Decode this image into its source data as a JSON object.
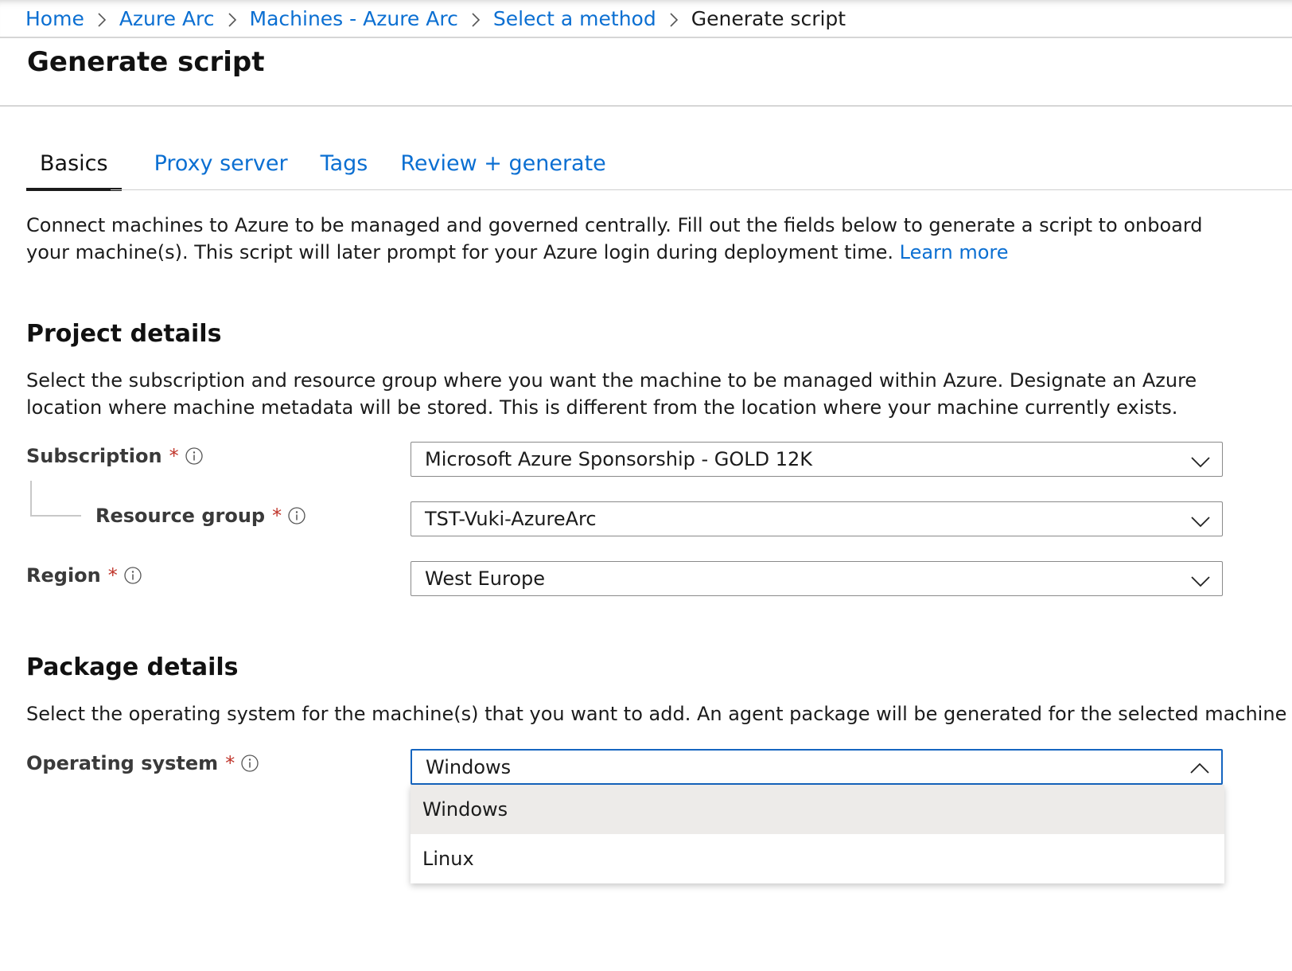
{
  "breadcrumb": {
    "items": [
      "Home",
      "Azure Arc",
      "Machines - Azure Arc",
      "Select a method"
    ],
    "current": "Generate script"
  },
  "page_title": "Generate script",
  "tabs": [
    "Basics",
    "Proxy server",
    "Tags",
    "Review + generate"
  ],
  "active_tab": "Basics",
  "intro": {
    "text": "Connect machines to Azure to be managed and governed centrally. Fill out the fields below to generate a script to onboard your machine(s). This script will later prompt for your Azure login during deployment time.",
    "link": "Learn more"
  },
  "project": {
    "title": "Project details",
    "description": "Select the subscription and resource group where you want the machine to be managed within Azure. Designate an Azure location where machine metadata will be stored. This is different from the location where your machine currently exists.",
    "subscription_label": "Subscription",
    "subscription_value": "Microsoft Azure Sponsorship - GOLD 12K",
    "resource_group_label": "Resource group",
    "resource_group_value": "TST-Vuki-AzureArc",
    "region_label": "Region",
    "region_value": "West Europe"
  },
  "package": {
    "title": "Package details",
    "description": "Select the operating system for the machine(s) that you want to add. An agent package will be generated for the selected machine type.",
    "os_label": "Operating system",
    "os_value": "Windows",
    "os_options": [
      "Windows",
      "Linux"
    ],
    "os_selected": "Windows"
  },
  "required_marker": "*",
  "icons": {
    "breadcrumb_separator": "chevron-right-icon",
    "info": "info-icon",
    "dropdown_closed": "chevron-down-icon",
    "dropdown_open": "chevron-up-icon"
  },
  "colors": {
    "link": "#0b6fd2",
    "required": "#c0352b",
    "focus_border": "#1565c0",
    "selected_option_bg": "#edebe9"
  }
}
